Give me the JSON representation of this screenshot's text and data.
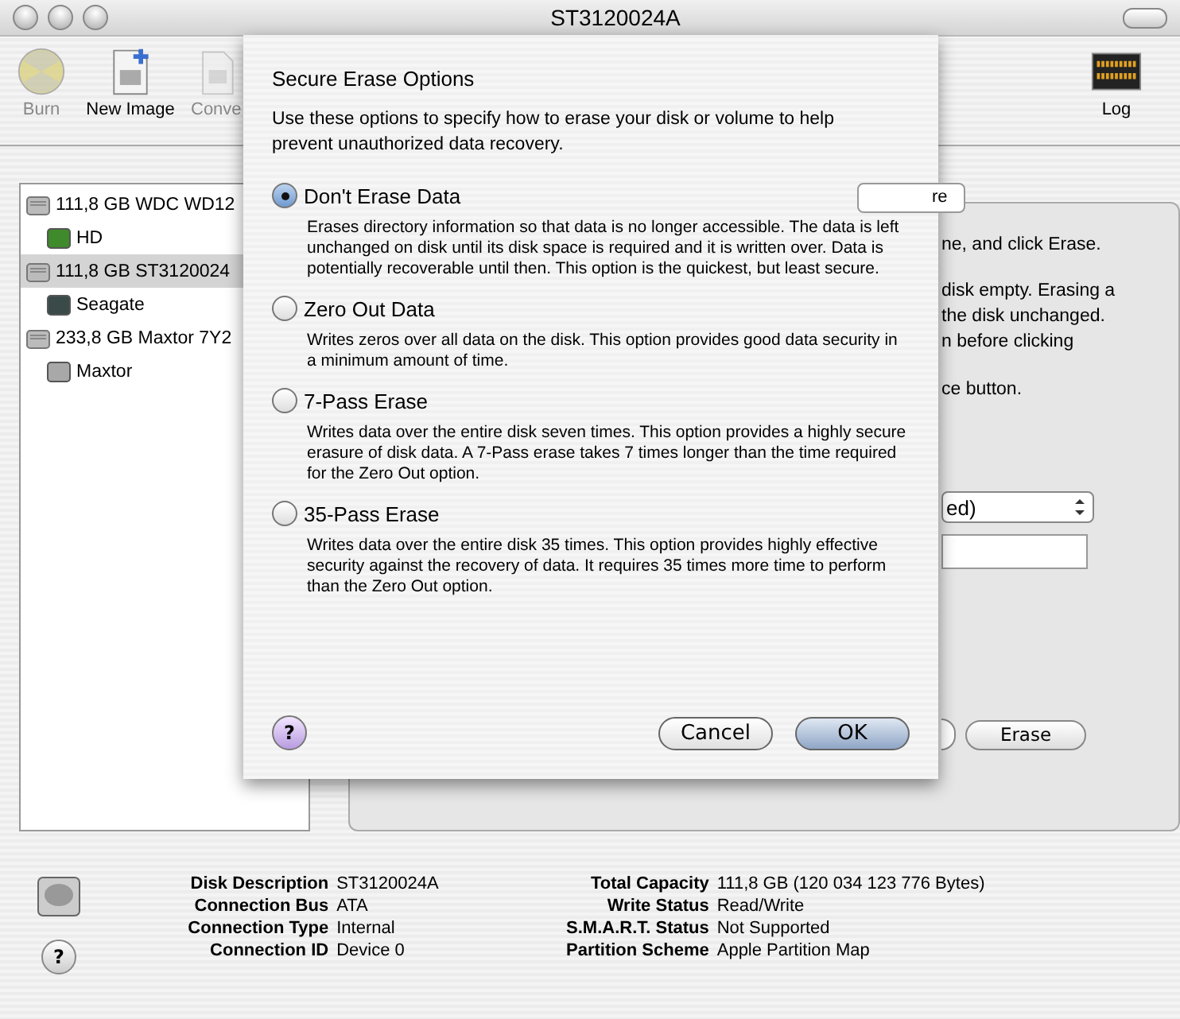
{
  "window": {
    "title": "ST3120024A"
  },
  "toolbar": [
    {
      "label": "Burn",
      "kind": "burn",
      "disabled": true
    },
    {
      "label": "New Image",
      "kind": "image",
      "disabled": false
    },
    {
      "label": "Conve",
      "kind": "convert",
      "disabled": true
    }
  ],
  "log": {
    "label": "Log"
  },
  "sidebar": {
    "items": [
      {
        "label": "111,8 GB WDC WD12",
        "selected": false,
        "children": [
          {
            "label": "HD",
            "selected": false,
            "color": "#3f8a2a"
          }
        ]
      },
      {
        "label": "111,8 GB ST3120024",
        "selected": true,
        "children": [
          {
            "label": "Seagate",
            "selected": false,
            "color": "#3a4a48"
          }
        ]
      },
      {
        "label": "233,8 GB Maxtor 7Y2",
        "selected": false,
        "children": [
          {
            "label": "Maxtor",
            "selected": false,
            "color": "#a8a8a8"
          }
        ]
      }
    ]
  },
  "panel": {
    "tab_fragment": "re",
    "lines": [
      "ne, and click Erase.",
      "disk empty. Erasing a",
      "the disk unchanged.",
      "n before clicking",
      "ce button."
    ],
    "format_popup": "ed)",
    "erase_button": "Erase"
  },
  "info": {
    "left": [
      {
        "key": "Disk Description",
        "value": "ST3120024A"
      },
      {
        "key": "Connection Bus",
        "value": "ATA"
      },
      {
        "key": "Connection Type",
        "value": "Internal"
      },
      {
        "key": "Connection ID",
        "value": "Device 0"
      }
    ],
    "right": [
      {
        "key": "Total Capacity",
        "value": "111,8 GB (120 034 123 776 Bytes)"
      },
      {
        "key": "Write Status",
        "value": "Read/Write"
      },
      {
        "key": "S.M.A.R.T. Status",
        "value": "Not Supported"
      },
      {
        "key": "Partition Scheme",
        "value": "Apple Partition Map"
      }
    ]
  },
  "sheet": {
    "title": "Secure Erase Options",
    "intro": "Use these options to specify how to erase your disk or volume to help prevent unauthorized data recovery.",
    "options": [
      {
        "label": "Don't Erase Data",
        "selected": true,
        "description": "Erases directory information so that data is no longer accessible. The data is left unchanged on disk until its disk space is required and it is written over. Data is potentially recoverable until then. This option is the quickest, but least secure."
      },
      {
        "label": "Zero Out Data",
        "selected": false,
        "description": "Writes zeros over all data on the disk. This option provides good data security in a minimum amount of time."
      },
      {
        "label": "7-Pass Erase",
        "selected": false,
        "description": "Writes data over the entire disk seven times. This option provides a highly secure erasure of disk data. A 7-Pass erase takes 7 times longer than the time required for the Zero Out option."
      },
      {
        "label": "35-Pass Erase",
        "selected": false,
        "description": "Writes data over the entire disk 35 times. This option provides highly effective security against the recovery of data. It requires 35 times more time to perform than the Zero Out option."
      }
    ],
    "help": "?",
    "cancel": "Cancel",
    "ok": "OK"
  },
  "help_button": "?"
}
